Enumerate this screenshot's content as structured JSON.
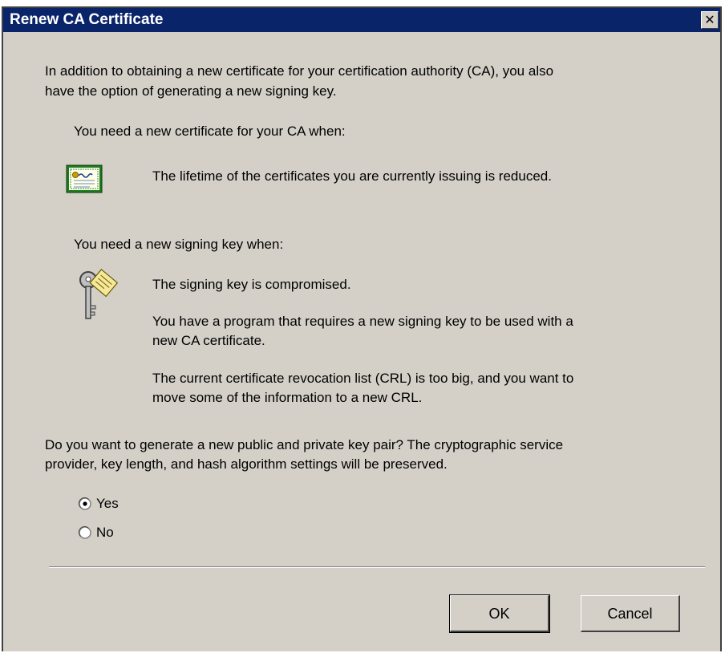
{
  "window": {
    "title": "Renew CA Certificate",
    "close_glyph": "✕"
  },
  "intro": {
    "line1": "In addition to obtaining a new certificate for your certification authority (CA), you also",
    "line2": "have the option of generating a new signing key."
  },
  "cert_section": {
    "heading": "You need a new certificate for your CA when:",
    "icon": "certificate-icon",
    "reason": "The lifetime of the certificates you are currently issuing is reduced."
  },
  "key_section": {
    "heading": "You need a new signing key when:",
    "icon": "key-icon",
    "reason1": "The signing key is compromised.",
    "reason2_line1": "You have a program that requires a new signing key to be used with a",
    "reason2_line2": "new CA certificate.",
    "reason3_line1": "The current certificate revocation list (CRL) is too big, and you want to",
    "reason3_line2": "move some of the information to a new CRL."
  },
  "question": {
    "line1": "Do you want to generate a new public and private key pair? The cryptographic service",
    "line2": "provider, key length, and hash algorithm settings will be preserved."
  },
  "options": {
    "yes_label": "Yes",
    "no_label": "No",
    "selected": "Yes"
  },
  "buttons": {
    "ok_label": "OK",
    "cancel_label": "Cancel"
  },
  "colors": {
    "titlebar": "#0a246a",
    "dialog_bg": "#d4d0c8"
  }
}
